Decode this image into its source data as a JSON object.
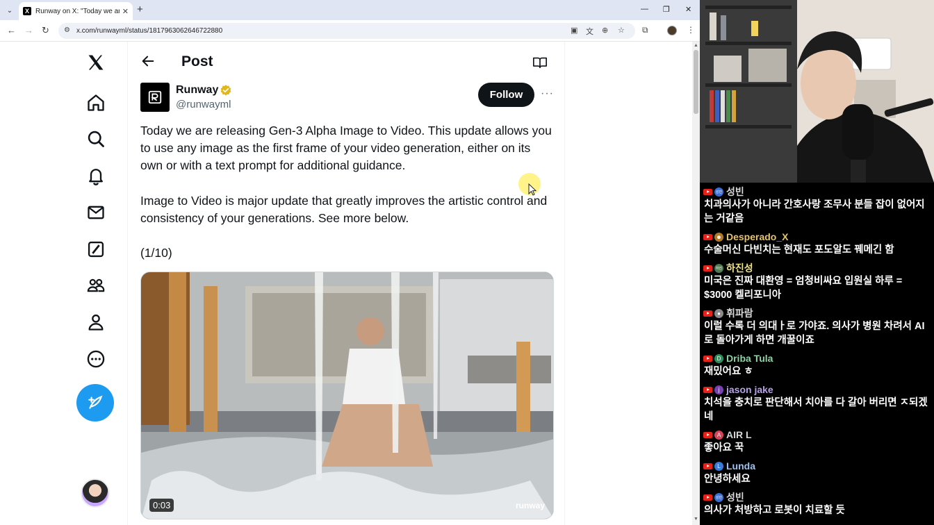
{
  "browser": {
    "tab_title": "Runway on X: \"Today we are r",
    "tab_favicon": "X",
    "url": "x.com/runwayml/status/1817963062646722880"
  },
  "post": {
    "header_title": "Post",
    "author_name": "Runway",
    "author_handle": "@runwayml",
    "follow_label": "Follow",
    "more_label": "···",
    "paragraphs": [
      "Today we are releasing Gen-3 Alpha Image to Video. This update allows you to use any image as the first frame of your video generation, either on its own or with a text prompt for additional guidance.",
      "Image to Video is major update that greatly improves the artistic control and consistency of your generations. See more below.",
      "(1/10)"
    ],
    "media_time": "0:03",
    "media_watermark": "runway"
  },
  "icons": {
    "nav": [
      "x-logo-icon",
      "home-icon",
      "search-icon",
      "bell-icon",
      "mail-icon",
      "grok-icon",
      "communities-icon",
      "profile-icon",
      "more-circle-icon",
      "compose-icon"
    ],
    "verified_color": "#e2b719",
    "accent": "#1d9bf0"
  },
  "chat": {
    "messages": [
      {
        "user": "성빈",
        "avatar_text": "성빈",
        "avatar_color": "#3b6fd6",
        "name_color": "#d8d8d8",
        "text": "치과의사가 아니라 간호사랑 조무사 분들 잡이 없어지는 거같음"
      },
      {
        "user": "Desperado_X",
        "avatar_text": "",
        "avatar_color": "#b07a28",
        "name_color": "#e7c46b",
        "text": "수술머신 다빈치는 현재도 포도알도 꿰메긴 함"
      },
      {
        "user": "하진성",
        "avatar_text": "하진",
        "avatar_color": "#4f7a52",
        "name_color": "#f0e48a",
        "text": "미국은 진짜 대환영 = 엄청비싸요 입원실 하루 = $3000 켈리포니아"
      },
      {
        "user": "휘파람",
        "avatar_text": "",
        "avatar_color": "#8a8a8a",
        "name_color": "#d8d8d8",
        "text": "이럴 수록 더 의대ㅏ로 가야죠. 의사가 병원 차려서 AI로 돌아가게 하면 개꿀이죠"
      },
      {
        "user": "Driba Tula",
        "avatar_text": "D",
        "avatar_color": "#2f8f5b",
        "name_color": "#8fd3a5",
        "text": "재밌어요 ㅎ"
      },
      {
        "user": "jason jake",
        "avatar_text": "j",
        "avatar_color": "#7b3fb8",
        "name_color": "#b8a3e8",
        "text": "치석을 충치로 판단해서 치아를 다 갈아 버리면 ㅈ되겠네"
      },
      {
        "user": "AIR L",
        "avatar_text": "A",
        "avatar_color": "#d4445a",
        "name_color": "#d8d8d8",
        "text": "좋아요 꾹"
      },
      {
        "user": "Lunda",
        "avatar_text": "L",
        "avatar_color": "#3b7bd6",
        "name_color": "#9cc4ee",
        "text": "안녕하세요"
      },
      {
        "user": "성빈",
        "avatar_text": "성빈",
        "avatar_color": "#3b6fd6",
        "name_color": "#d8d8d8",
        "text": "의사가 처방하고 로봇이 치료할 듯"
      }
    ]
  }
}
